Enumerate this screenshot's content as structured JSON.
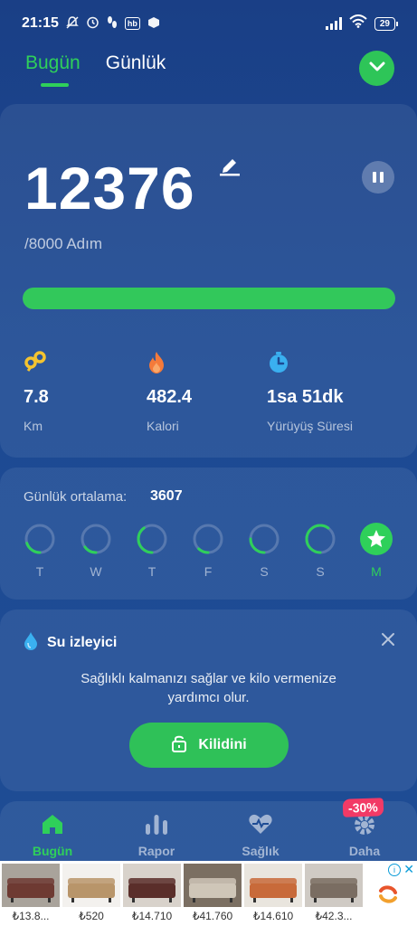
{
  "status_bar": {
    "time": "21:15",
    "box_label": "hb",
    "battery": "29"
  },
  "tabs": [
    {
      "label": "Bugün"
    },
    {
      "label": "Günlük"
    }
  ],
  "steps": {
    "value": "12376",
    "goal_text": "/8000 Adım",
    "progress": 1.0
  },
  "stats": [
    {
      "value": "7.8",
      "label": "Km",
      "icon": "distance-icon",
      "color": "#f4c430"
    },
    {
      "value": "482.4",
      "label": "Kalori",
      "icon": "flame-icon",
      "color": "#f47a3a"
    },
    {
      "value": "1sa 51dk",
      "label": "Yürüyüş Süresi",
      "icon": "stopwatch-icon",
      "color": "#3ab0f0"
    }
  ],
  "weekly": {
    "avg_label": "Günlük ortalama:",
    "avg_value": "3607",
    "days": [
      {
        "label": "T",
        "progress": 0.2
      },
      {
        "label": "W",
        "progress": 0.15
      },
      {
        "label": "T",
        "progress": 0.4
      },
      {
        "label": "F",
        "progress": 0.12
      },
      {
        "label": "S",
        "progress": 0.25
      },
      {
        "label": "S",
        "progress": 0.6
      },
      {
        "label": "M",
        "progress": 1.0,
        "today": true
      }
    ]
  },
  "water": {
    "title": "Su izleyici",
    "description": "Sağlıklı kalmanızı sağlar ve kilo vermenize yardımcı olur.",
    "button": "Kilidini"
  },
  "nav": [
    {
      "label": "Bugün",
      "icon": "home-icon"
    },
    {
      "label": "Rapor",
      "icon": "bar-chart-icon"
    },
    {
      "label": "Sağlık",
      "icon": "heart-pulse-icon"
    },
    {
      "label": "Daha",
      "icon": "gear-icon"
    }
  ],
  "badge": "-30%",
  "ads": [
    {
      "price": "₺13.8..."
    },
    {
      "price": "₺520"
    },
    {
      "price": "₺14.710"
    },
    {
      "price": "₺41.760"
    },
    {
      "price": "₺14.610"
    },
    {
      "price": "₺42.3..."
    }
  ],
  "colors": {
    "accent": "#2fd05a",
    "background": "#1d4a93"
  }
}
